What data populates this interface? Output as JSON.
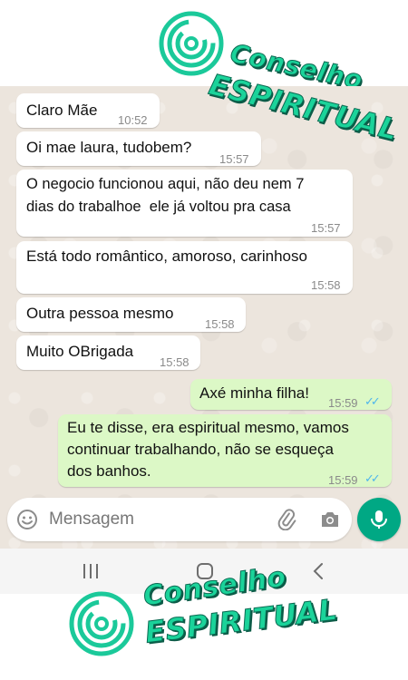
{
  "watermark": {
    "top_line1": "Conselho",
    "top_line2": "ESPIRITUAL",
    "bottom_line1": "Conselho",
    "bottom_line2": "ESPIRITUAL",
    "color": "#1bd39a"
  },
  "messages": [
    {
      "direction": "in",
      "text": "Claro Mãe",
      "time": "10:52"
    },
    {
      "direction": "in",
      "text": "Oi mae laura, tudobem?",
      "time": "15:57"
    },
    {
      "direction": "in",
      "text": "O negocio funcionou aqui, não deu nem 7\ndias do trabalhoe  ele já voltou pra casa",
      "time": "15:57"
    },
    {
      "direction": "in",
      "text": "Está todo romântico, amoroso, carinhoso",
      "time": "15:58"
    },
    {
      "direction": "in",
      "text": "Outra pessoa mesmo",
      "time": "15:58"
    },
    {
      "direction": "in",
      "text": "Muito OBrigada",
      "time": "15:58"
    },
    {
      "direction": "out",
      "text": "Axé minha filha!",
      "time": "15:59",
      "status": "read"
    },
    {
      "direction": "out",
      "text": "Eu te disse, era espiritual mesmo, vamos\ncontinuar trabalhando, não se esqueça\ndos banhos.",
      "time": "15:59",
      "status": "read"
    }
  ],
  "composer": {
    "placeholder": "Mensagem",
    "emoji_icon": "emoji-icon",
    "attach_icon": "paperclip-icon",
    "camera_icon": "camera-icon",
    "mic_icon": "mic-icon"
  },
  "navbar": {
    "recents_icon": "recent-apps-icon",
    "home_icon": "home-icon",
    "back_icon": "back-icon"
  },
  "colors": {
    "chat_background": "#ece5dd",
    "incoming_bubble": "#ffffff",
    "outgoing_bubble": "#dcf8c6",
    "accent": "#00a884",
    "read_ticks": "#4fb6ec"
  }
}
